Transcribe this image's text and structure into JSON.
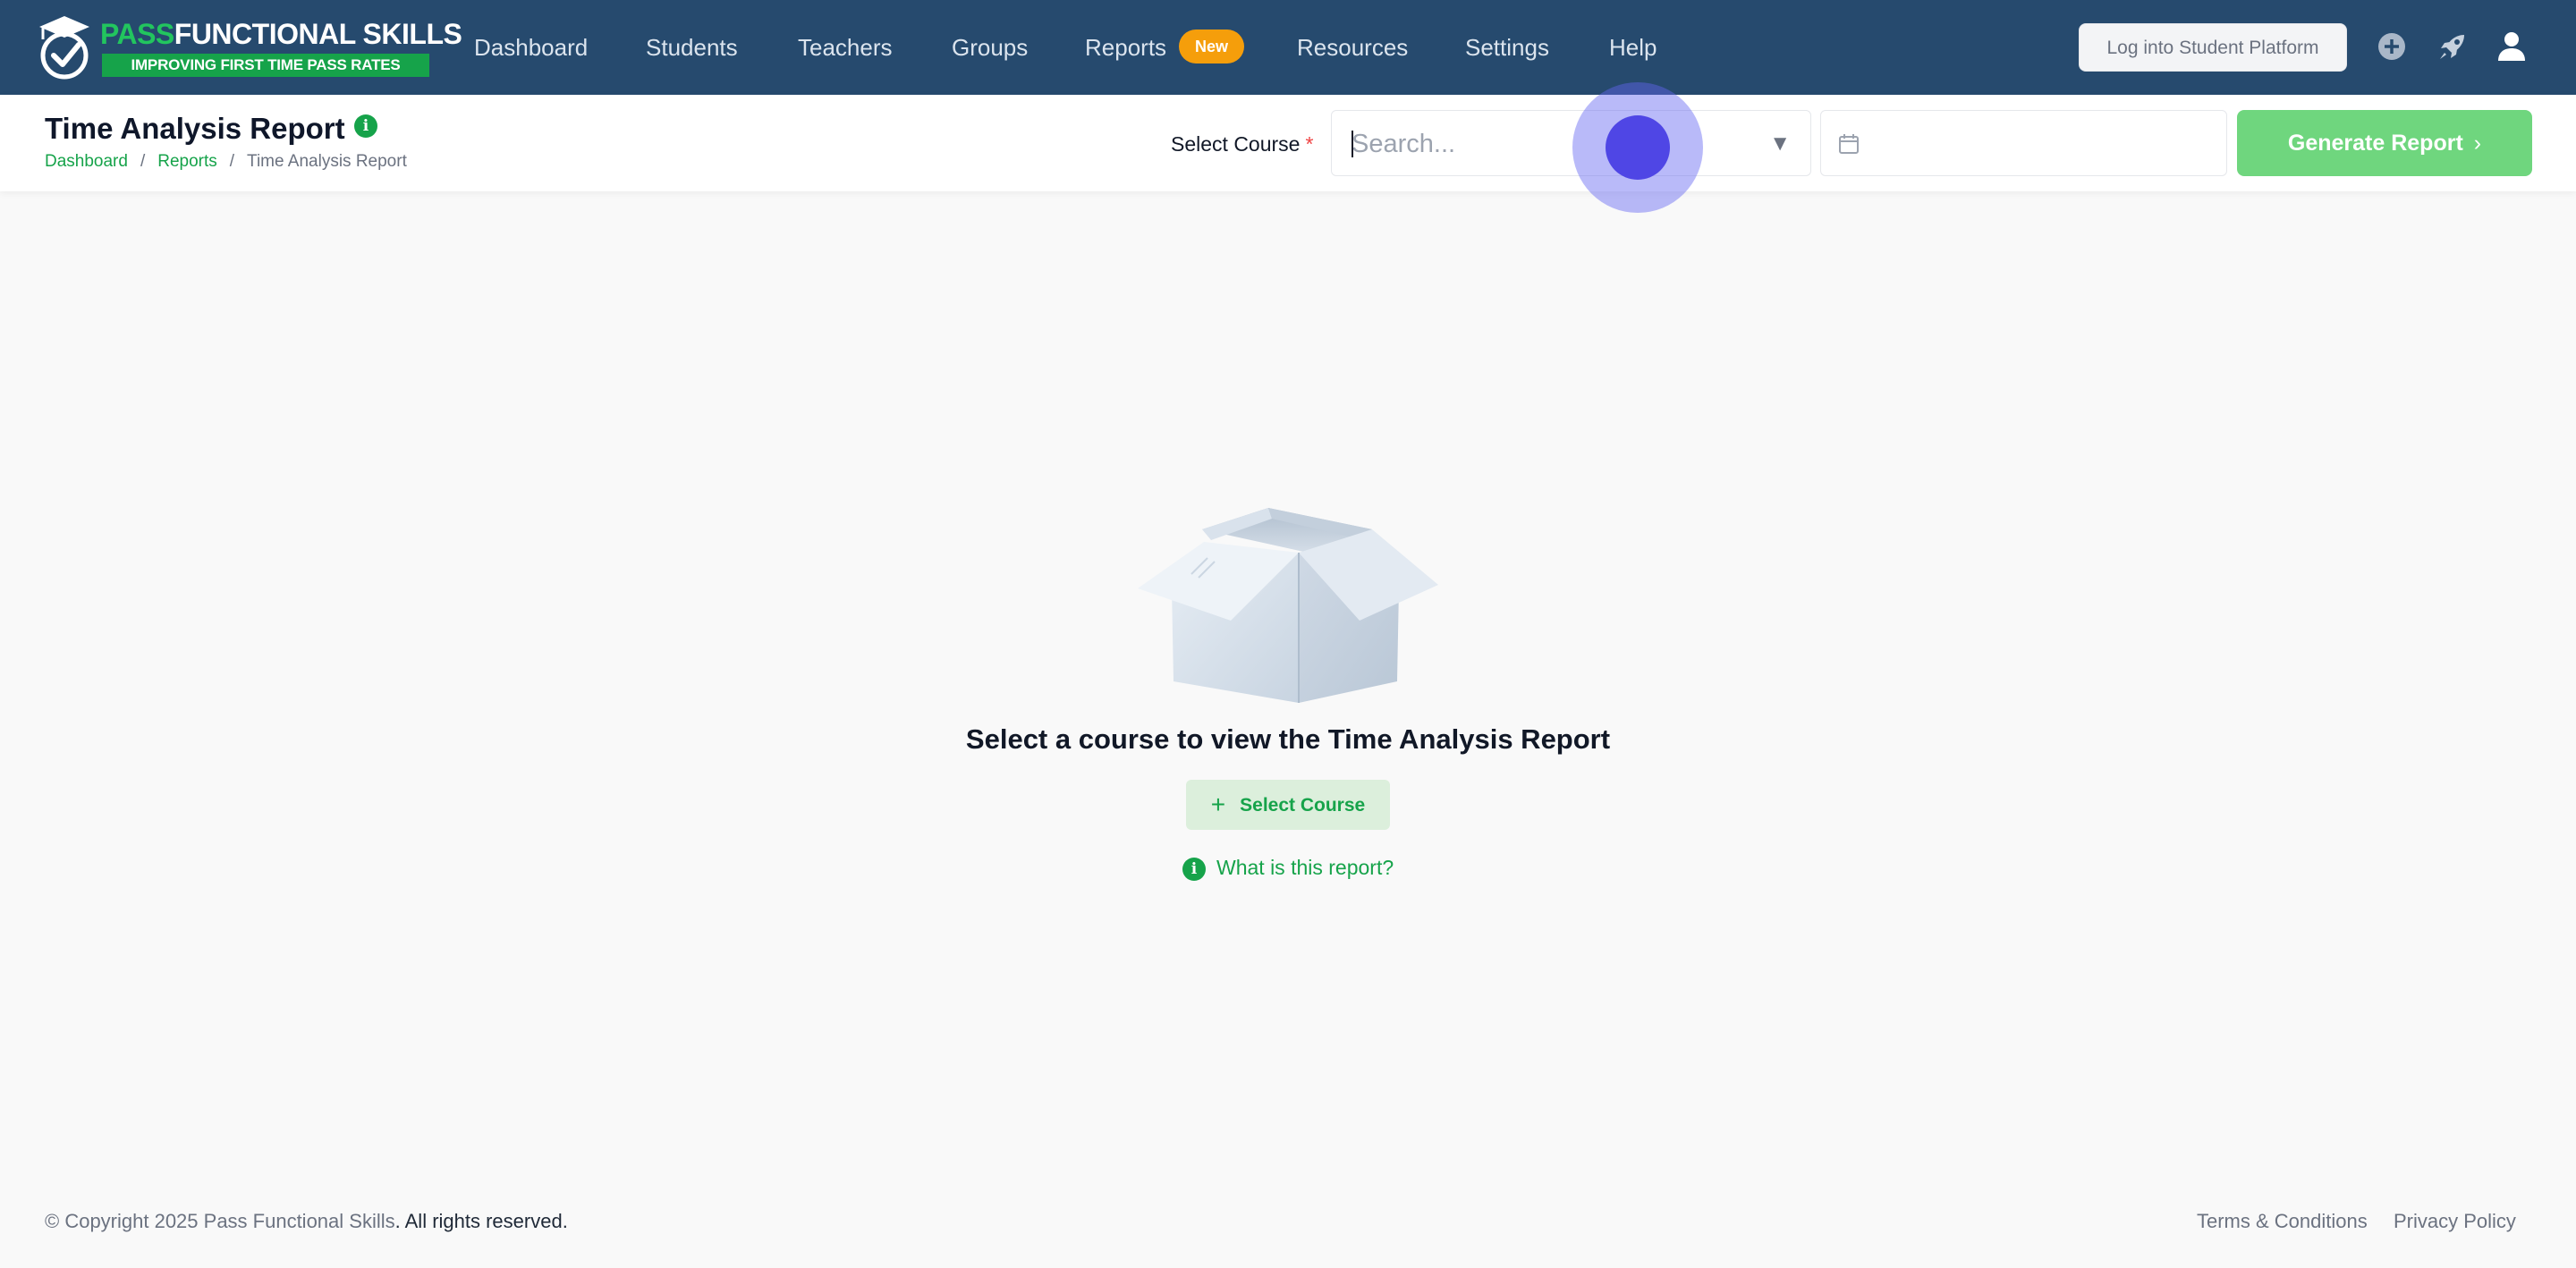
{
  "brand": {
    "name_part1": "PASS",
    "name_part2": "FUNCTIONAL SKILLS",
    "tagline": "IMPROVING FIRST TIME PASS RATES",
    "colors": {
      "navbar": "#264a6e",
      "accent_green": "#16a34a",
      "logo_green": "#22c55e",
      "badge_orange": "#f59e0b"
    }
  },
  "nav": {
    "items": [
      {
        "label": "Dashboard"
      },
      {
        "label": "Students"
      },
      {
        "label": "Teachers"
      },
      {
        "label": "Groups"
      },
      {
        "label": "Reports"
      },
      {
        "label": "Resources"
      },
      {
        "label": "Settings"
      },
      {
        "label": "Help"
      }
    ],
    "reports_badge": "New",
    "login_button": "Log into Student Platform",
    "icons": [
      "plus-circle-icon",
      "rocket-icon",
      "user-icon"
    ]
  },
  "subheader": {
    "title": "Time Analysis Report",
    "breadcrumb": {
      "dashboard": "Dashboard",
      "reports": "Reports",
      "current": "Time Analysis Report",
      "separator": "/"
    },
    "course_label": "Select Course",
    "required_mark": "*",
    "course_search_placeholder": "Search...",
    "date_value": "",
    "generate_button": "Generate Report"
  },
  "empty_state": {
    "message": "Select a course to view the Time Analysis Report",
    "select_course_button": "Select Course",
    "info_link": "What is this report?"
  },
  "footer": {
    "copyright_prefix": "© Copyright 2025 Pass Functional Skills",
    "copyright_suffix": ". All rights reserved.",
    "terms": "Terms & Conditions",
    "privacy": "Privacy Policy"
  }
}
